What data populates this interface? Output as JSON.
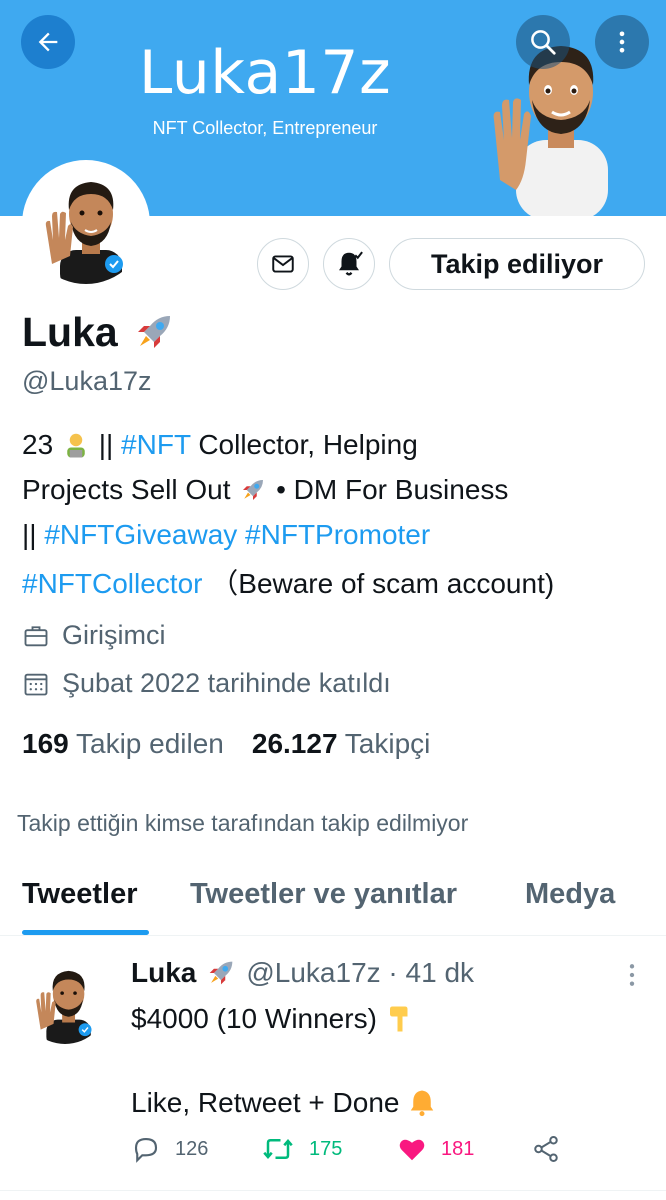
{
  "banner": {
    "title": "Luka17z",
    "subtitle": "NFT Collector, Entrepreneur",
    "color": "#3fa9f0"
  },
  "topbar": {
    "back_icon": "arrow-left-icon",
    "search_icon": "search-icon",
    "more_icon": "more-vertical-icon"
  },
  "profile": {
    "follow_button": "Takip ediliyor",
    "name": "Luka",
    "name_emoji": "rocket",
    "handle": "@Luka17z",
    "bio": {
      "line1_a": "23 ",
      "line1_b": " || ",
      "line1_tag": "#NFT",
      "line1_c": " Collector, Helping",
      "line2_a": "Projects Sell Out ",
      "line2_b": " • DM For Business",
      "line3_a": "|| ",
      "line3_tag1": "#NFTGiveaway",
      "line3_tag2": "#NFTPromoter",
      "line4_tag": "#NFTCollector",
      "line4_text": "（Beware of scam account)"
    },
    "job": "Girişimci",
    "joined": "Şubat 2022 tarihinde katıldı",
    "following_count": "169",
    "following_label": "Takip edilen",
    "followers_count": "26.127",
    "followers_label": "Takipçi",
    "not_followed_note": "Takip ettiğin kimse tarafından takip edilmiyor"
  },
  "tabs": [
    {
      "label": "Tweetler",
      "active": true
    },
    {
      "label": "Tweetler ve yanıtlar",
      "active": false
    },
    {
      "label": "Medya",
      "active": false
    }
  ],
  "tweet": {
    "name": "Luka",
    "handle_time": "@Luka17z · 41 dk",
    "line1": "$4000 (10 Winners) ",
    "line2": "Like, Retweet + Done ",
    "replies": "126",
    "retweets": "175",
    "likes": "181"
  },
  "colors": {
    "accent": "#1d9bf0",
    "retweet": "#00ba7c",
    "like": "#f91880",
    "muted": "#536471"
  }
}
